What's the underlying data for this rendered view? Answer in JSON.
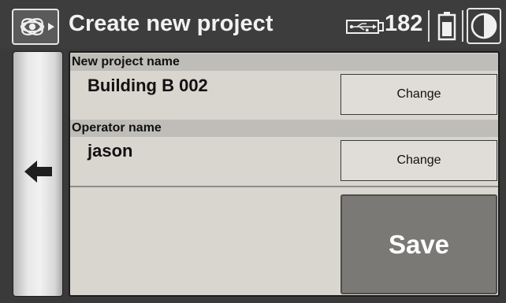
{
  "header": {
    "title": "Create new project",
    "storage_count": "182",
    "icons": [
      "app-logo-icon",
      "usb-storage-icon",
      "battery-icon",
      "contrast-icon"
    ]
  },
  "nav": {
    "back_icon": "back-arrow-icon"
  },
  "form": {
    "project": {
      "label": "New project name",
      "value": "Building B 002",
      "button": "Change"
    },
    "operator": {
      "label": "Operator name",
      "value": "jason",
      "button": "Change"
    },
    "save_label": "Save"
  },
  "colors": {
    "header_bg": "#3d3d3d",
    "panel_bg": "#d9d5cf",
    "section_header_bg": "#bfbdb8",
    "save_bg": "#7b7975"
  }
}
